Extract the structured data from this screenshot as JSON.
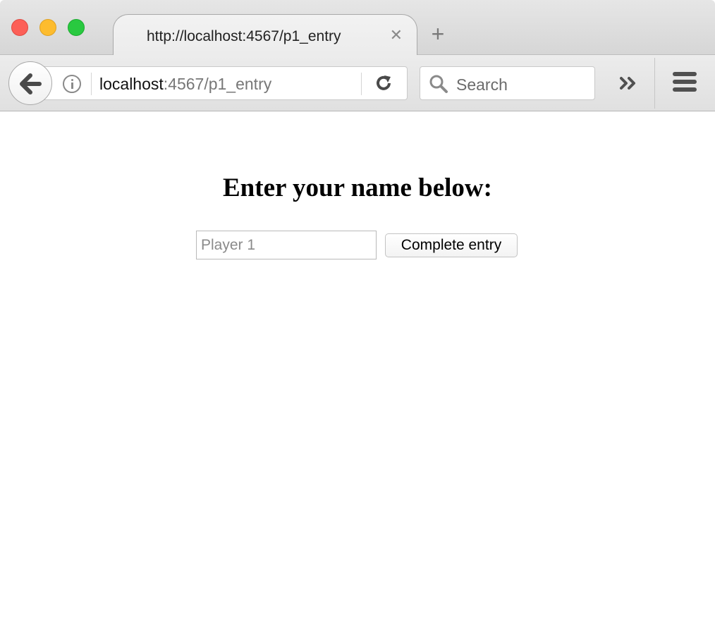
{
  "tabs": [
    {
      "title": "http://localhost:4567/p1_entry",
      "close_glyph": "✕"
    }
  ],
  "new_tab_glyph": "+",
  "url_bar": {
    "host": "localhost",
    "path": ":4567/p1_entry"
  },
  "search": {
    "placeholder": "Search"
  },
  "page": {
    "heading": "Enter your name below:",
    "name_input": {
      "placeholder": "Player 1",
      "value": ""
    },
    "submit_label": "Complete entry"
  },
  "icons": [
    "back-arrow-icon",
    "info-icon",
    "reload-icon",
    "search-icon",
    "overflow-chevrons-icon",
    "hamburger-menu-icon",
    "close-icon",
    "plus-icon"
  ],
  "colors": {
    "traffic_close": "#fc5f57",
    "traffic_minimize": "#fdbc2e",
    "traffic_maximize": "#29c940"
  }
}
